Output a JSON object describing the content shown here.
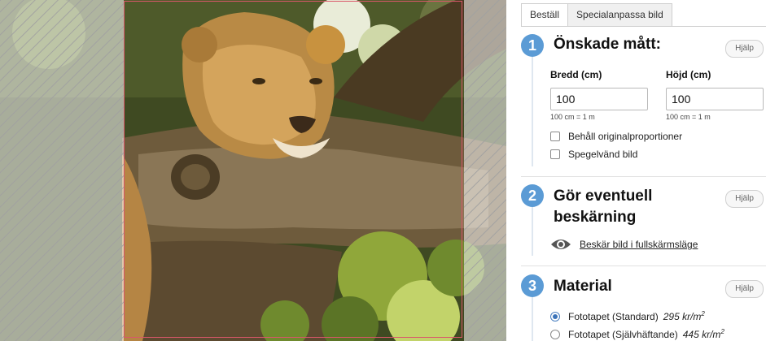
{
  "tabs": [
    {
      "label": "Beställ",
      "active": true
    },
    {
      "label": "Specialanpassa bild",
      "active": false
    }
  ],
  "steps": [
    {
      "number": "1",
      "title": "Önskade mått",
      "help": "Hjälp"
    },
    {
      "number": "2",
      "title_line1": "Gör eventuell",
      "title_line2": "beskärning",
      "help": "Hjälp"
    },
    {
      "number": "3",
      "title": "Material",
      "help": "Hjälp"
    }
  ],
  "dimensions": {
    "width_label": "Bredd (cm)",
    "width_value": "100",
    "width_hint": "100 cm = 1 m",
    "height_label": "Höjd (cm)",
    "height_value": "100",
    "height_hint": "100 cm = 1 m"
  },
  "options": {
    "keep_proportions": "Behåll originalproportioner",
    "mirror": "Spegelvänd bild"
  },
  "crop": {
    "link_label": "Beskär bild i fullskärmsläge",
    "icon": "eye-icon"
  },
  "materials": [
    {
      "label": "Fototapet (Standard)",
      "price": "295 kr/m",
      "exp": "2",
      "selected": true
    },
    {
      "label": "Fototapet (Självhäftande)",
      "price": "445 kr/m",
      "exp": "2",
      "selected": false
    }
  ],
  "colors": {
    "accent": "#5b9bd5",
    "crop_frame": "#d9576a"
  }
}
